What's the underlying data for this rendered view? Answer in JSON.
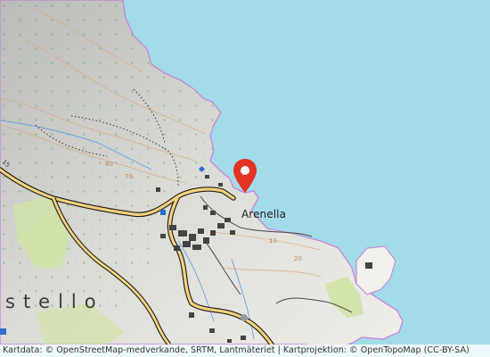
{
  "map": {
    "place_label": "Arenella",
    "district_label": "stello",
    "marker_icon": "location-pin-icon",
    "colors": {
      "sea": "#a3dce9",
      "land": "#e9e9e2",
      "coast": "#c58bdc",
      "marker": "#e43323",
      "road_major": "#f3d17c",
      "road_casing": "#1e1e1e",
      "forest_symbol": "#2fa34d",
      "grass": "#cfe3a6"
    },
    "road_ref": "15",
    "contour_labels": [
      "80",
      "70",
      "10",
      "20"
    ]
  },
  "attribution": {
    "text": "Kartdata: © OpenStreetMap-medverkande, SRTM, Lantmäteriet | Kartprojektion: © OpenTopoMap (CC-BY-SA)"
  }
}
